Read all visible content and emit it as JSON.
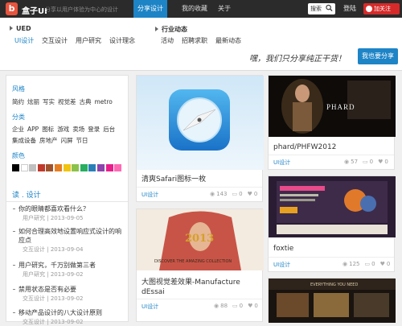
{
  "header": {
    "logo_mark": "b",
    "logo_text": "盒子UI",
    "slogan": "分享以用户体验为中心的设计",
    "nav": [
      "分享设计",
      "我的收藏",
      "关于"
    ],
    "search_label": "搜索",
    "login": "登陆",
    "weibo": "加关注"
  },
  "subnav": {
    "group1": {
      "title": "UED",
      "items": [
        "UI设计",
        "交互设计",
        "用户研究",
        "设计理念"
      ]
    },
    "group2": {
      "title": "行业动态",
      "items": [
        "活动",
        "招聘求职",
        "最新动态"
      ]
    },
    "tagline": "嘿，我们只分享纯正干货！",
    "share_button": "我也要分享"
  },
  "sidebar": {
    "style_head": "风格",
    "styles": [
      "简约",
      "炫丽",
      "写实",
      "视觉差",
      "古典",
      "metro"
    ],
    "cat_head": "分类",
    "cats1": [
      "企业",
      "APP",
      "图标",
      "游戏",
      "卖场",
      "登录",
      "后台"
    ],
    "cats2": [
      "集成设备",
      "房地产",
      "闪屏",
      "节日"
    ],
    "color_head": "颜色",
    "colors": [
      "#000000",
      "#ffffff",
      "#c0c0c0",
      "#c0392b",
      "#a0522d",
      "#e67e22",
      "#f1c40f",
      "#8bc34a",
      "#27ae60",
      "#2980b9",
      "#8e44ad",
      "#e91e8c",
      "#ff69b4"
    ],
    "read_head": "读 . 设计",
    "articles": [
      {
        "title": "你的眼睛都喜欢看什么？",
        "cat": "用户研究",
        "date": "2013-09-05"
      },
      {
        "title": "如何合理高效地设置响应式设计的响应点",
        "cat": "交互设计",
        "date": "2013-09-04"
      },
      {
        "title": "用户研究，千万别做第三者",
        "cat": "用户研究",
        "date": "2013-09-02"
      },
      {
        "title": "禁用状态是否有必要",
        "cat": "交互设计",
        "date": "2013-09-02"
      },
      {
        "title": "移动产品设计的八大设计原则",
        "cat": "交互设计",
        "date": "2013-09-02"
      }
    ]
  },
  "cards": [
    {
      "title": "清爽Safari图标一枚",
      "cat": "UI设计",
      "views": "143",
      "comments": "0",
      "likes": "0"
    },
    {
      "title": "phard/PHFW2012",
      "cat": "UI设计",
      "views": "57",
      "comments": "0",
      "likes": "0"
    },
    {
      "title": "大图视觉差效果-Manufacture dEssai",
      "cat": "UI设计",
      "views": "88",
      "comments": "0",
      "likes": "0"
    },
    {
      "title": "foxtie",
      "cat": "UI设计",
      "views": "125",
      "comments": "0",
      "likes": "0"
    }
  ],
  "images": {
    "phard_label": "PHARD",
    "manufacture_year": "2013",
    "manufacture_caption": "DISCOVER THE AMAZING COLLECTION",
    "skate_label": "EVERYTHING YOU NEED"
  }
}
